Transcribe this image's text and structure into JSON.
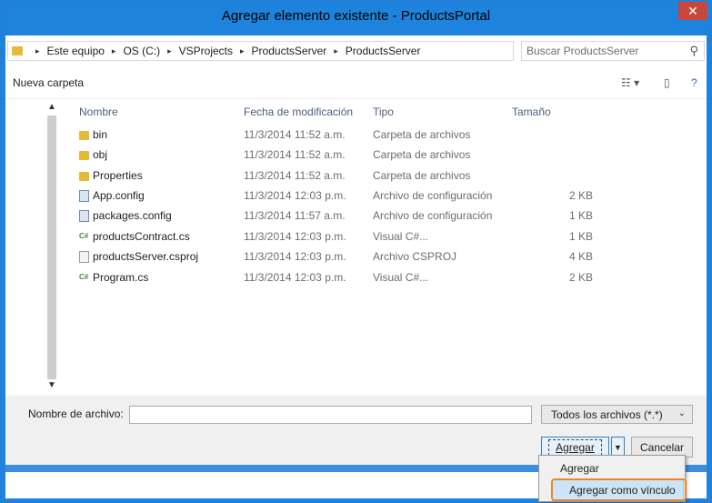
{
  "window": {
    "title": "Agregar elemento existente - ProductsPortal",
    "close_glyph": "✕"
  },
  "address": {
    "crumbs": [
      "Este equipo",
      "OS (C:)",
      "VSProjects",
      "ProductsServer",
      "ProductsServer"
    ],
    "separator": "▸"
  },
  "search": {
    "placeholder": "Buscar ProductsServer",
    "icon": "search-icon"
  },
  "toolbar": {
    "new_folder": "Nueva carpeta",
    "view_icon": "view-options-icon",
    "preview_icon": "preview-pane-icon",
    "help_icon": "help-icon"
  },
  "columns": {
    "name": "Nombre",
    "date": "Fecha de modificación",
    "type": "Tipo",
    "size": "Tamaño"
  },
  "files": [
    {
      "name": "bin",
      "date": "11/3/2014 11:52 a.m.",
      "type": "Carpeta de archivos",
      "size": "",
      "icon": "folder-icon"
    },
    {
      "name": "obj",
      "date": "11/3/2014 11:52 a.m.",
      "type": "Carpeta de archivos",
      "size": "",
      "icon": "folder-icon"
    },
    {
      "name": "Properties",
      "date": "11/3/2014 11:52 a.m.",
      "type": "Carpeta de archivos",
      "size": "",
      "icon": "folder-icon"
    },
    {
      "name": "App.config",
      "date": "11/3/2014 12:03 p.m.",
      "type": "Archivo de configuración",
      "size": "2 KB",
      "icon": "config-file-icon"
    },
    {
      "name": "packages.config",
      "date": "11/3/2014 11:57 a.m.",
      "type": "Archivo de configuración",
      "size": "1 KB",
      "icon": "config-file-icon"
    },
    {
      "name": "productsContract.cs",
      "date": "11/3/2014 12:03 p.m.",
      "type": "Visual C#...",
      "size": "1 KB",
      "icon": "csharp-file-icon"
    },
    {
      "name": "productsServer.csproj",
      "date": "11/3/2014 12:03 p.m.",
      "type": "Archivo CSPROJ",
      "size": "4 KB",
      "icon": "project-file-icon"
    },
    {
      "name": "Program.cs",
      "date": "11/3/2014 12:03 p.m.",
      "type": "Visual C#...",
      "size": "2 KB",
      "icon": "csharp-file-icon"
    }
  ],
  "footer": {
    "filename_label": "Nombre de archivo:",
    "filename_value": "",
    "filter": "Todos los archivos (*.*)",
    "add": "Agregar",
    "cancel": "Cancelar"
  },
  "menu": {
    "items": [
      "Agregar",
      "Agregar como vínculo"
    ]
  },
  "colors": {
    "title_bar": "#1e83dc",
    "highlight_ring": "#f08622",
    "folder": "#e8b936"
  }
}
